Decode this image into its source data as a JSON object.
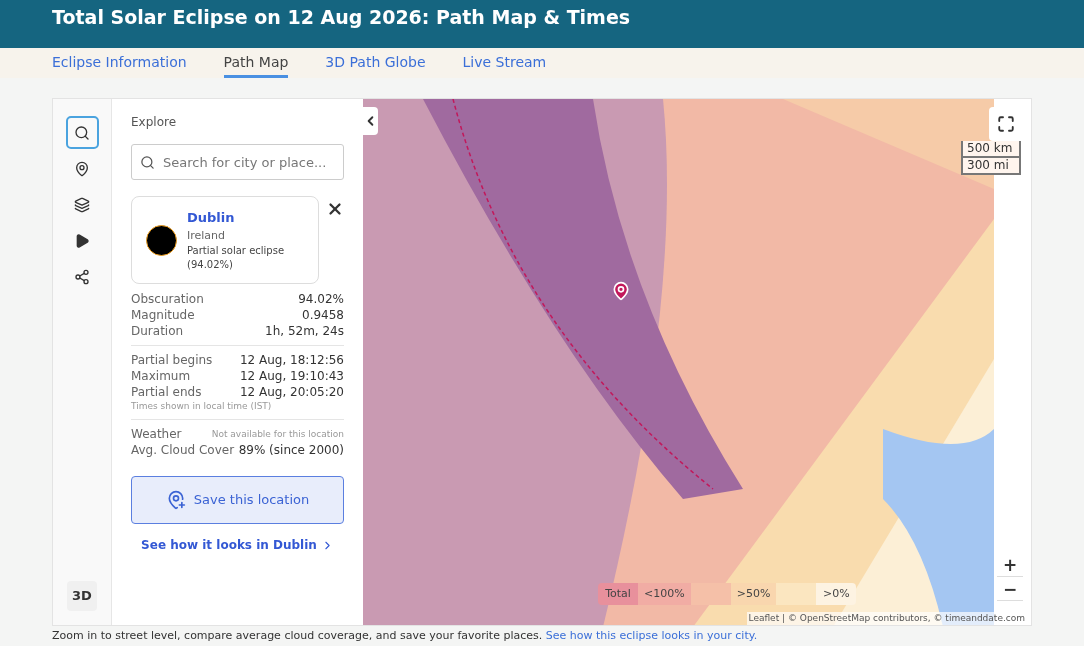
{
  "header": {
    "title": "Total Solar Eclipse on 12 Aug 2026: Path Map & Times"
  },
  "tabs": [
    {
      "label": "Eclipse Information",
      "selected": false
    },
    {
      "label": "Path Map",
      "selected": true
    },
    {
      "label": "3D Path Globe",
      "selected": false
    },
    {
      "label": "Live Stream",
      "selected": false
    }
  ],
  "rail": {
    "items": [
      {
        "kind": "search",
        "selected": true
      },
      {
        "kind": "pin",
        "selected": false
      },
      {
        "kind": "layers",
        "selected": false
      },
      {
        "kind": "play",
        "selected": false
      },
      {
        "kind": "share",
        "selected": false
      }
    ],
    "bottom_button": "3D"
  },
  "panel": {
    "heading": "Explore",
    "search": {
      "placeholder": "Search for city or place..."
    },
    "location": {
      "name": "Dublin",
      "country": "Ireland",
      "description": "Partial solar eclipse (94.02%)"
    },
    "stats": [
      {
        "label": "Obscuration",
        "value": "94.02%"
      },
      {
        "label": "Magnitude",
        "value": "0.9458"
      },
      {
        "label": "Duration",
        "value": "1h, 52m, 24s"
      }
    ],
    "times": [
      {
        "label": "Partial begins",
        "value": "12 Aug, 18:12:56"
      },
      {
        "label": "Maximum",
        "value": "12 Aug, 19:10:43"
      },
      {
        "label": "Partial ends",
        "value": "12 Aug, 20:05:20"
      }
    ],
    "times_note": "Times shown in local time (IST)",
    "weather": [
      {
        "label": "Weather",
        "value": "Not available for this location",
        "kind": "note"
      },
      {
        "label": "Avg. Cloud Cover",
        "value": "89% (since 2000)",
        "kind": "value"
      }
    ],
    "save_button": "Save this location",
    "link": "See how it looks in Dublin"
  },
  "map": {
    "scale": [
      "500 km",
      "300 mi"
    ],
    "legend": [
      {
        "label": "Total",
        "color": "#e8909c"
      },
      {
        "label": "<100%",
        "color": "#f1aca4"
      },
      {
        "color": "#f5c0a8"
      },
      {
        "label": ">50%",
        "color": "#f9d6ae"
      },
      {
        "color": "#fbe6c0"
      },
      {
        "label": ">0%",
        "color": "#fdf3e2"
      }
    ],
    "zoom": [
      "+",
      "−"
    ],
    "attribution": "Leaflet | © OpenStreetMap contributors, © timeanddate.com"
  },
  "footer": {
    "text": "Zoom in to street level, compare average cloud coverage, and save your favorite places.",
    "link": "See how this eclipse looks in your city."
  }
}
